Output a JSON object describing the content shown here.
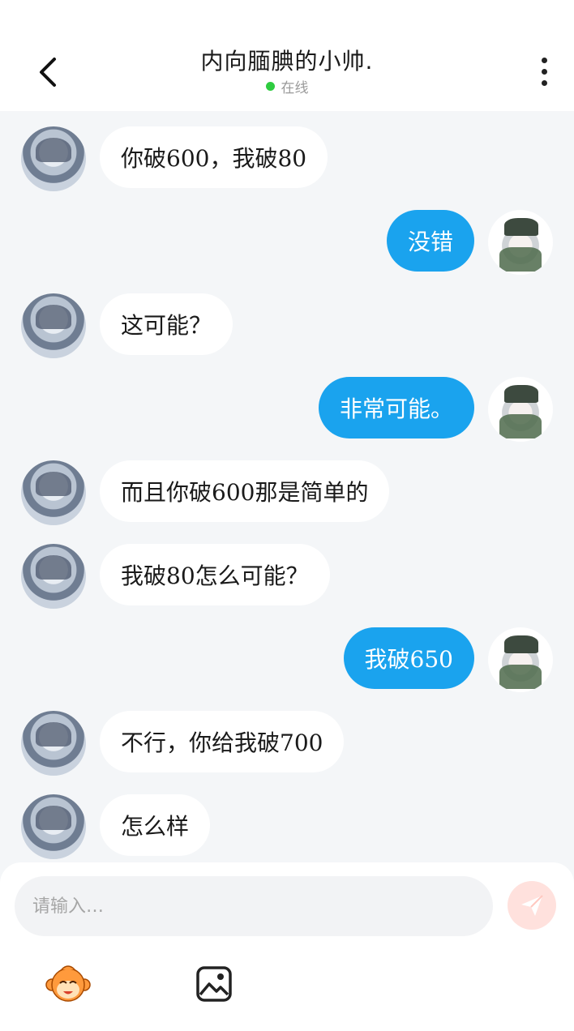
{
  "header": {
    "title": "内向腼腆的小帅.",
    "status": "在线",
    "status_color": "#2ecc40"
  },
  "icons": {
    "back": "chevron-left-icon",
    "more": "more-vertical-icon",
    "send": "paper-plane-icon",
    "sticker": "monkey-face-icon",
    "image": "image-icon"
  },
  "colors": {
    "outgoing_bubble": "#1aa3ee",
    "incoming_bubble": "#ffffff",
    "send_button": "#ffe1dd"
  },
  "messages": [
    {
      "side": "left",
      "text": "你破600，我破80"
    },
    {
      "side": "right",
      "text": "没错"
    },
    {
      "side": "left",
      "text": "这可能？"
    },
    {
      "side": "right",
      "text": "非常可能。"
    },
    {
      "side": "left",
      "text": "而且你破600那是简单的"
    },
    {
      "side": "left",
      "text": "我破80怎么可能？"
    },
    {
      "side": "right",
      "text": "我破650"
    },
    {
      "side": "left",
      "text": "不行，你给我破700"
    },
    {
      "side": "left",
      "text": "怎么样"
    }
  ],
  "composer": {
    "placeholder": "请输入…"
  }
}
